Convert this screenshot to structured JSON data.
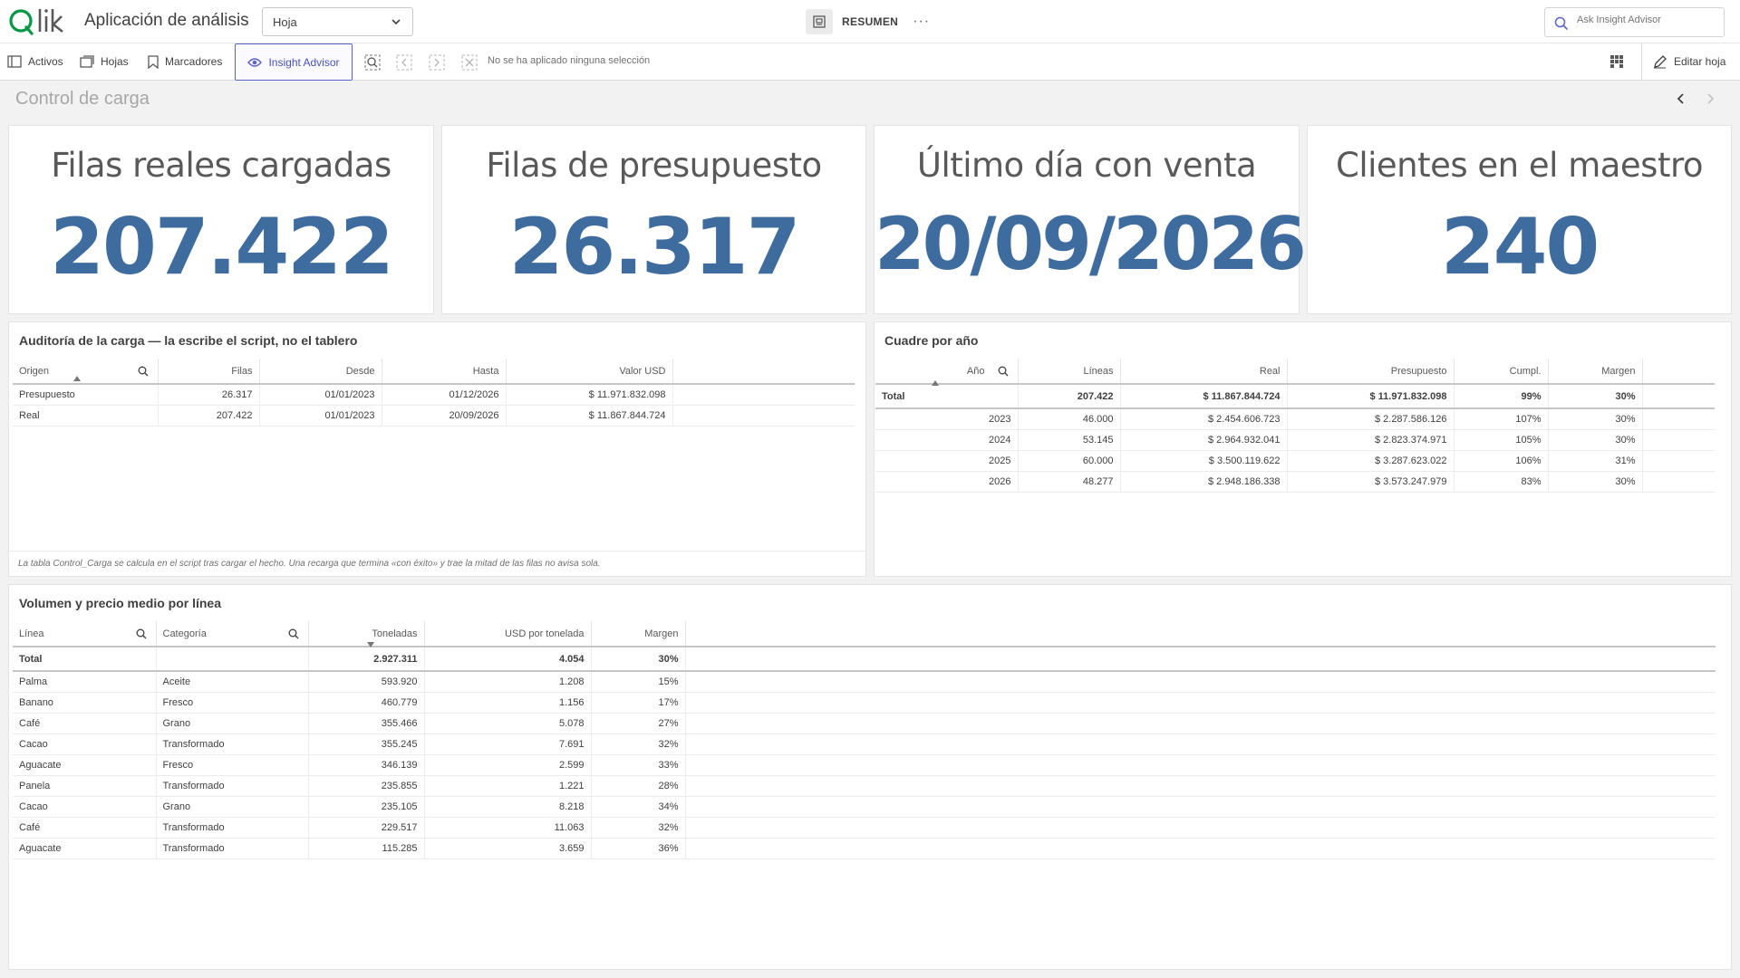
{
  "header": {
    "app_title": "Aplicación de análisis",
    "sheet_selector": "Hoja",
    "sheet_view_label": "RESUMEN",
    "more_label": "···",
    "ask_placeholder": "Ask Insight Advisor"
  },
  "toolbar": {
    "assets": "Activos",
    "sheets": "Hojas",
    "bookmarks": "Marcadores",
    "insight_advisor": "Insight Advisor",
    "no_selection": "No se ha aplicado ninguna selección",
    "edit_sheet": "Editar hoja"
  },
  "sheet": {
    "title": "Control de carga"
  },
  "kpis": [
    {
      "title": "Filas reales cargadas",
      "value": "207.422"
    },
    {
      "title": "Filas de presupuesto",
      "value": "26.317"
    },
    {
      "title": "Último día con venta",
      "value": "20/09/2026"
    },
    {
      "title": "Clientes en el maestro",
      "value": "240"
    }
  ],
  "audit": {
    "title": "Auditoría de la carga — la escribe el script, no el tablero",
    "columns": [
      "Origen",
      "Filas",
      "Desde",
      "Hasta",
      "Valor USD"
    ],
    "rows": [
      [
        "Presupuesto",
        "26.317",
        "01/01/2023",
        "01/12/2026",
        "$ 11.971.832.098"
      ],
      [
        "Real",
        "207.422",
        "01/01/2023",
        "20/09/2026",
        "$ 11.867.844.724"
      ]
    ],
    "footnote": "La tabla Control_Carga se calcula en el script tras cargar el hecho. Una recarga que termina «con éxito» y trae la mitad de las filas no avisa sola."
  },
  "by_year": {
    "title": "Cuadre por año",
    "columns": [
      "Año",
      "Líneas",
      "Real",
      "Presupuesto",
      "Cumpl.",
      "Margen"
    ],
    "total": [
      "Total",
      "207.422",
      "$ 11.867.844.724",
      "$ 11.971.832.098",
      "99%",
      "30%"
    ],
    "rows": [
      [
        "2023",
        "46.000",
        "$ 2.454.606.723",
        "$ 2.287.586.126",
        "107%",
        "30%"
      ],
      [
        "2024",
        "53.145",
        "$ 2.964.932.041",
        "$ 2.823.374.971",
        "105%",
        "30%"
      ],
      [
        "2025",
        "60.000",
        "$ 3.500.119.622",
        "$ 3.287.623.022",
        "106%",
        "31%"
      ],
      [
        "2026",
        "48.277",
        "$ 2.948.186.338",
        "$ 3.573.247.979",
        "83%",
        "30%"
      ]
    ]
  },
  "volume": {
    "title": "Volumen y precio medio por línea",
    "columns": [
      "Línea",
      "Categoría",
      "Toneladas",
      "USD por tonelada",
      "Margen"
    ],
    "total": [
      "Total",
      "",
      "2.927.311",
      "4.054",
      "30%"
    ],
    "rows": [
      [
        "Palma",
        "Aceite",
        "593.920",
        "1.208",
        "15%"
      ],
      [
        "Banano",
        "Fresco",
        "460.779",
        "1.156",
        "17%"
      ],
      [
        "Café",
        "Grano",
        "355.466",
        "5.078",
        "27%"
      ],
      [
        "Cacao",
        "Transformado",
        "355.245",
        "7.691",
        "32%"
      ],
      [
        "Aguacate",
        "Fresco",
        "346.139",
        "2.599",
        "33%"
      ],
      [
        "Panela",
        "Transformado",
        "235.855",
        "1.221",
        "28%"
      ],
      [
        "Cacao",
        "Grano",
        "235.105",
        "8.218",
        "34%"
      ],
      [
        "Café",
        "Transformado",
        "229.517",
        "11.063",
        "32%"
      ],
      [
        "Aguacate",
        "Transformado",
        "115.285",
        "3.659",
        "36%"
      ]
    ]
  },
  "colors": {
    "kpi_value": "#3e6c9e",
    "brand_green": "#009845",
    "insight_accent": "#5b63c7"
  }
}
